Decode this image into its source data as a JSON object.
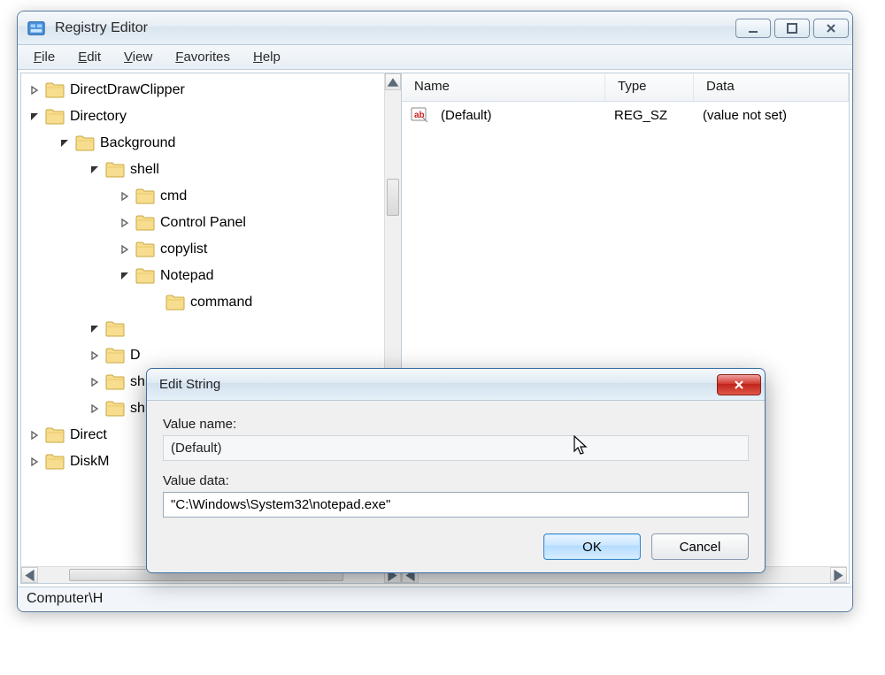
{
  "window": {
    "title": "Registry Editor"
  },
  "menu": {
    "file": "File",
    "edit": "Edit",
    "view": "View",
    "favorites": "Favorites",
    "help": "Help"
  },
  "tree": {
    "items": [
      {
        "label": "DirectDrawClipper",
        "depth": 0,
        "expander": "closed"
      },
      {
        "label": "Directory",
        "depth": 0,
        "expander": "open"
      },
      {
        "label": "Background",
        "depth": 1,
        "expander": "open"
      },
      {
        "label": "shell",
        "depth": 2,
        "expander": "open"
      },
      {
        "label": "cmd",
        "depth": 3,
        "expander": "closed"
      },
      {
        "label": "Control Panel",
        "depth": 3,
        "expander": "closed"
      },
      {
        "label": "copylist",
        "depth": 3,
        "expander": "closed"
      },
      {
        "label": "Notepad",
        "depth": 3,
        "expander": "open"
      },
      {
        "label": "command",
        "depth": 4,
        "expander": "none"
      },
      {
        "label": "",
        "depth": 2,
        "expander": "open",
        "truncated": true
      },
      {
        "label": "D",
        "depth": 2,
        "expander": "closed",
        "truncated": true
      },
      {
        "label": "sh",
        "depth": 2,
        "expander": "closed",
        "truncated": true
      },
      {
        "label": "sh",
        "depth": 2,
        "expander": "closed",
        "truncated": true
      },
      {
        "label": "Direct",
        "depth": 0,
        "expander": "closed",
        "truncated": true
      },
      {
        "label": "DiskM",
        "depth": 0,
        "expander": "closed",
        "truncated": true
      }
    ]
  },
  "list": {
    "columns": {
      "name": "Name",
      "type": "Type",
      "data": "Data"
    },
    "rows": [
      {
        "name": "(Default)",
        "type": "REG_SZ",
        "data": "(value not set)"
      }
    ]
  },
  "statusbar": {
    "path": "Computer\\H"
  },
  "dialog": {
    "title": "Edit String",
    "value_name_label": "Value name:",
    "value_name": "(Default)",
    "value_data_label": "Value data:",
    "value_data": "\"C:\\Windows\\System32\\notepad.exe\"",
    "ok": "OK",
    "cancel": "Cancel"
  }
}
